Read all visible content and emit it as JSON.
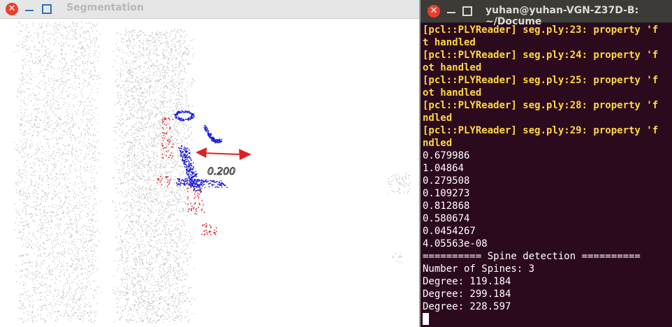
{
  "seg_window": {
    "title": "Segmentation",
    "arrow_label": "0.200"
  },
  "terminal": {
    "title": "yuhan@yuhan-VGN-Z37D-B: ~/Docume",
    "lines": [
      {
        "text": "[pcl::PLYReader] seg.ply:23: property 'f",
        "kind": "warn"
      },
      {
        "text": "t handled",
        "kind": "warn"
      },
      {
        "text": "[pcl::PLYReader] seg.ply:24: property 'f",
        "kind": "warn"
      },
      {
        "text": "ot handled",
        "kind": "warn"
      },
      {
        "text": "[pcl::PLYReader] seg.ply:25: property 'f",
        "kind": "warn"
      },
      {
        "text": "ot handled",
        "kind": "warn"
      },
      {
        "text": "[pcl::PLYReader] seg.ply:28: property 'f",
        "kind": "warn"
      },
      {
        "text": "ndled",
        "kind": "warn"
      },
      {
        "text": "[pcl::PLYReader] seg.ply:29: property 'f",
        "kind": "warn"
      },
      {
        "text": "ndled",
        "kind": "warn"
      },
      {
        "text": "0.679986",
        "kind": "out"
      },
      {
        "text": "1.04864",
        "kind": "out"
      },
      {
        "text": "0.279508",
        "kind": "out"
      },
      {
        "text": "0.109273",
        "kind": "out"
      },
      {
        "text": "0.812868",
        "kind": "out"
      },
      {
        "text": "0.580674",
        "kind": "out"
      },
      {
        "text": "0.0454267",
        "kind": "out"
      },
      {
        "text": "4.05563e-08",
        "kind": "out"
      },
      {
        "text": "========== Spine detection ==========",
        "kind": "out"
      },
      {
        "text": "Number of Spines: 3",
        "kind": "out"
      },
      {
        "text": "Degree: 119.184",
        "kind": "out"
      },
      {
        "text": "Degree: 299.184",
        "kind": "out"
      },
      {
        "text": "Degree: 228.597",
        "kind": "out"
      }
    ]
  },
  "colors": {
    "terminal_bg": "#2c0a1e",
    "warning_text": "#ffd740",
    "cloud_gray": "#bdbdbd",
    "segment_blue": "#1a1ad6",
    "segment_red": "#e02020",
    "close_button": "#e8402c"
  },
  "icons": {
    "close": "close-icon",
    "minimize": "minimize-icon",
    "maximize": "maximize-icon"
  }
}
